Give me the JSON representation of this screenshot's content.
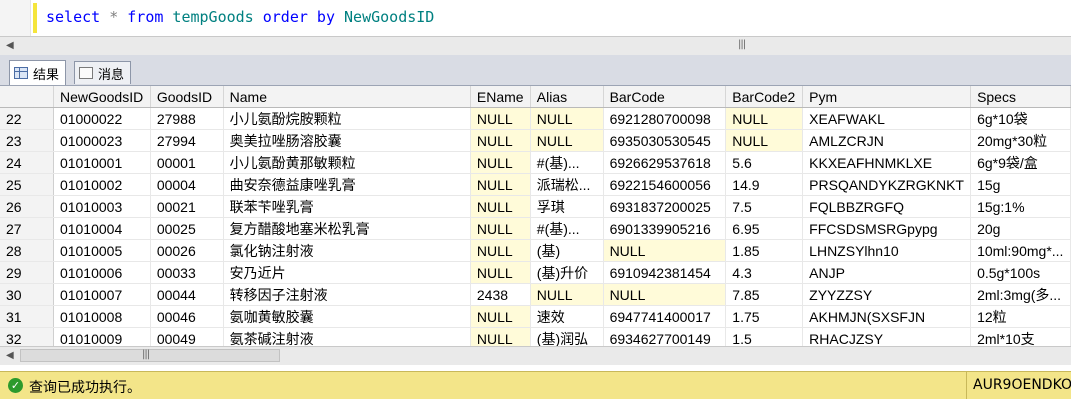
{
  "editor": {
    "sql": [
      {
        "t": "select",
        "c": "kw"
      },
      {
        "t": " * ",
        "c": "op"
      },
      {
        "t": "from",
        "c": "kw"
      },
      {
        "t": " tempGoods ",
        "c": "id"
      },
      {
        "t": "order by",
        "c": "kw"
      },
      {
        "t": " NewGoodsID",
        "c": "id"
      }
    ]
  },
  "tabs": [
    {
      "label": "结果",
      "icon": "grid-icon",
      "active": true
    },
    {
      "label": "消息",
      "icon": "message-icon",
      "active": false
    }
  ],
  "grid": {
    "columns": [
      "NewGoodsID",
      "GoodsID",
      "Name",
      "EName",
      "Alias",
      "BarCode",
      "BarCode2",
      "Pym",
      "Specs"
    ],
    "rows": [
      {
        "n": "22",
        "cells": [
          "01000022",
          "27988",
          "小儿氨酚烷胺颗粒",
          "NULL",
          "NULL",
          "6921280700098",
          "NULL",
          "XEAFWAKL",
          "6g*10袋"
        ]
      },
      {
        "n": "23",
        "cells": [
          "01000023",
          "27994",
          "奥美拉唑肠溶胶囊",
          "NULL",
          "NULL",
          "6935030530545",
          "NULL",
          "AMLZCRJN",
          "20mg*30粒"
        ]
      },
      {
        "n": "24",
        "cells": [
          "01010001",
          "00001",
          "小儿氨酚黄那敏颗粒",
          "NULL",
          "#(基)...",
          "6926629537618",
          "5.6",
          "KKXEAFHNMKLXE",
          "6g*9袋/盒"
        ]
      },
      {
        "n": "25",
        "cells": [
          "01010002",
          "00004",
          "曲安奈德益康唑乳膏",
          "NULL",
          "派瑞松...",
          "6922154600056",
          "14.9",
          "PRSQANDYKZRGKNKT",
          "15g"
        ]
      },
      {
        "n": "26",
        "cells": [
          "01010003",
          "00021",
          "联苯苄唑乳膏",
          "NULL",
          "孚琪",
          "6931837200025",
          "7.5",
          "FQLBBZRGFQ",
          "15g:1%"
        ]
      },
      {
        "n": "27",
        "cells": [
          "01010004",
          "00025",
          "复方醋酸地塞米松乳膏",
          "NULL",
          "#(基)...",
          "6901339905216",
          "6.95",
          "FFCSDSMSRGpypg",
          "20g"
        ]
      },
      {
        "n": "28",
        "cells": [
          "01010005",
          "00026",
          "氯化钠注射液",
          "NULL",
          "(基)",
          "NULL",
          "1.85",
          "LHNZSYlhn10",
          "10ml:90mg*..."
        ]
      },
      {
        "n": "29",
        "cells": [
          "01010006",
          "00033",
          "安乃近片",
          "NULL",
          "(基)升价",
          "6910942381454",
          "4.3",
          "ANJP",
          "0.5g*100s"
        ]
      },
      {
        "n": "30",
        "cells": [
          "01010007",
          "00044",
          "转移因子注射液",
          "2438",
          "NULL",
          "NULL",
          "7.85",
          "ZYYZZSY",
          "2ml:3mg(多..."
        ]
      },
      {
        "n": "31",
        "cells": [
          "01010008",
          "00046",
          "氨咖黄敏胶囊",
          "NULL",
          "速效",
          "6947741400017",
          "1.75",
          "AKHMJN(SXSFJN",
          "12粒"
        ]
      },
      {
        "n": "32",
        "cells": [
          "01010009",
          "00049",
          "氨茶碱注射液",
          "NULL",
          "(基)润弘",
          "6934627700149",
          "1.5",
          "RHACJZSY",
          "2ml*10支"
        ]
      }
    ]
  },
  "status": {
    "message": "查询已成功执行。",
    "server": "AUR9OENDKO"
  },
  "colors": {
    "status_bar": "#f3e589",
    "null_cell": "#fffbd9",
    "keyword": "#0000ff",
    "identifier": "#008080"
  }
}
